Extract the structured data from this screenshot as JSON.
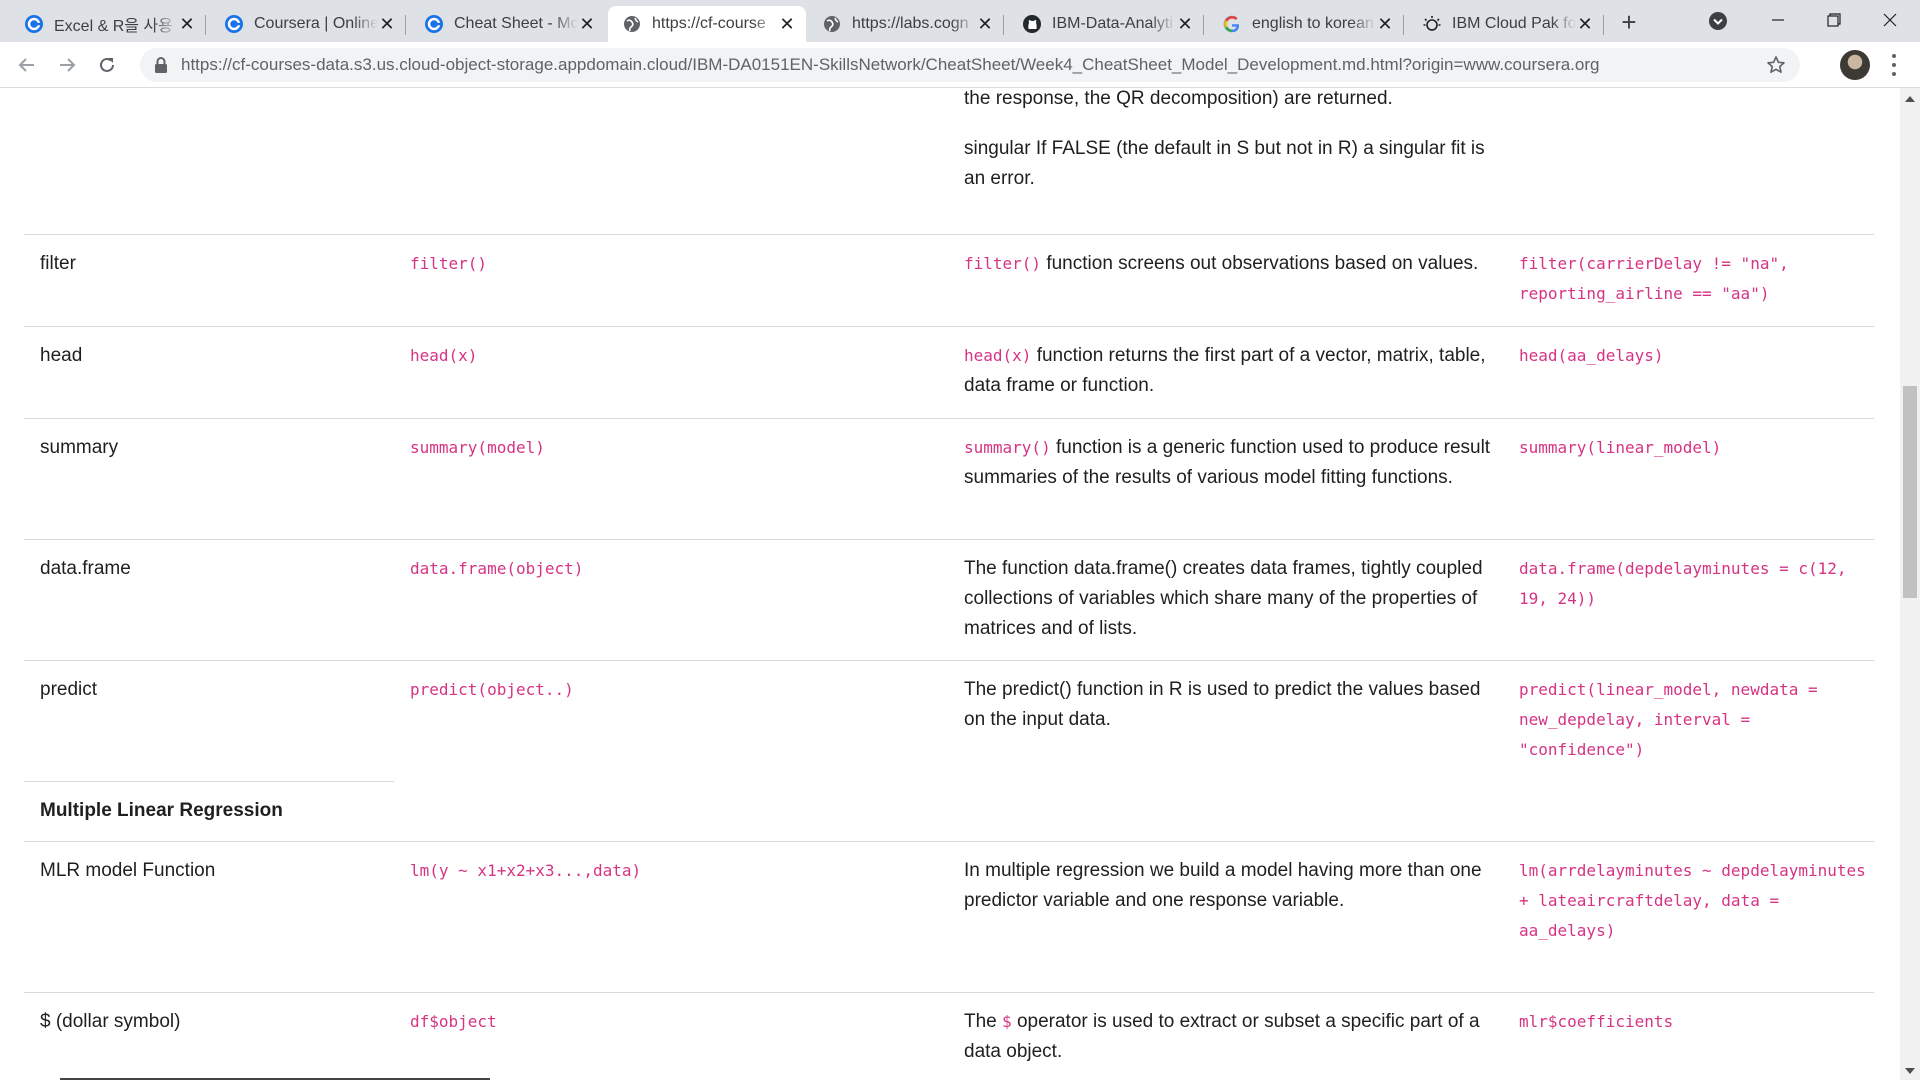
{
  "browser": {
    "tabs": [
      {
        "title": "Excel & R을 사용",
        "icon": "chrome-google-icon",
        "active": false
      },
      {
        "title": "Coursera | Online",
        "icon": "chrome-google-icon",
        "active": false
      },
      {
        "title": "Cheat Sheet - Mc",
        "icon": "chrome-google-icon",
        "active": false
      },
      {
        "title": "https://cf-course",
        "icon": "globe-icon",
        "active": true
      },
      {
        "title": "https://labs.cogn",
        "icon": "globe-icon",
        "active": false
      },
      {
        "title": "IBM-Data-Analyti",
        "icon": "github-icon",
        "active": false
      },
      {
        "title": "english to korean",
        "icon": "google-g-icon",
        "active": false
      },
      {
        "title": "IBM Cloud Pak fo",
        "icon": "ibm-cloud-pak-icon",
        "active": false
      }
    ],
    "url": "https://cf-courses-data.s3.us.cloud-object-storage.appdomain.cloud/IBM-DA0151EN-SkillsNetwork/CheatSheet/Week4_CheatSheet_Model_Development.md.html?origin=www.coursera.org"
  },
  "page": {
    "top_fragment": {
      "line1": "the response, the QR decomposition) are returned.",
      "line2": "singular If FALSE (the default in S but not in R) a singular fit is an error."
    },
    "rows": [
      {
        "name": "filter",
        "syntax": "filter()",
        "desc_code": "filter()",
        "desc": " function screens out observations based on values.",
        "example": "filter(carrierDelay != \"na\", reporting_airline == \"aa\")"
      },
      {
        "name": "head",
        "syntax": "head(x)",
        "desc_code": "head(x)",
        "desc": " function returns the first part of a vector, matrix, table, data frame or function.",
        "example": "head(aa_delays)"
      },
      {
        "name": "summary",
        "syntax": "summary(model)",
        "desc_code": "summary()",
        "desc": " function is a generic function used to produce result summaries of the results of various model fitting functions.",
        "example": "summary(linear_model)"
      },
      {
        "name": "data.frame",
        "syntax": "data.frame(object)",
        "desc_code": "",
        "desc": "The function data.frame() creates data frames, tightly coupled collections of variables which share many of the properties of matrices and of lists.",
        "example": "data.frame(depdelayminutes = c(12, 19, 24))"
      },
      {
        "name": "predict",
        "syntax": "predict(object..)",
        "desc_code": "",
        "desc": "The predict() function in R is used to predict the values based on the input data.",
        "example": "predict(linear_model, newdata = new_depdelay, interval = \"confidence\")"
      }
    ],
    "section_title": "Multiple Linear Regression",
    "mlr_rows": [
      {
        "name": "MLR model Function",
        "syntax": "lm(y ~ x1+x2+x3...,data)",
        "desc_code": "",
        "desc": "In multiple regression we build a model having more than one predictor variable and one response variable.",
        "example": "lm(arrdelayminutes ~ depdelayminutes + lateaircraftdelay, data = aa_delays)"
      },
      {
        "name": "$ (dollar symbol)",
        "syntax": "df$object",
        "desc_prefix": "The ",
        "desc_code": "$",
        "desc": " operator is used to extract or subset a specific part of a data object.",
        "example": "mlr$coefficients"
      }
    ]
  }
}
